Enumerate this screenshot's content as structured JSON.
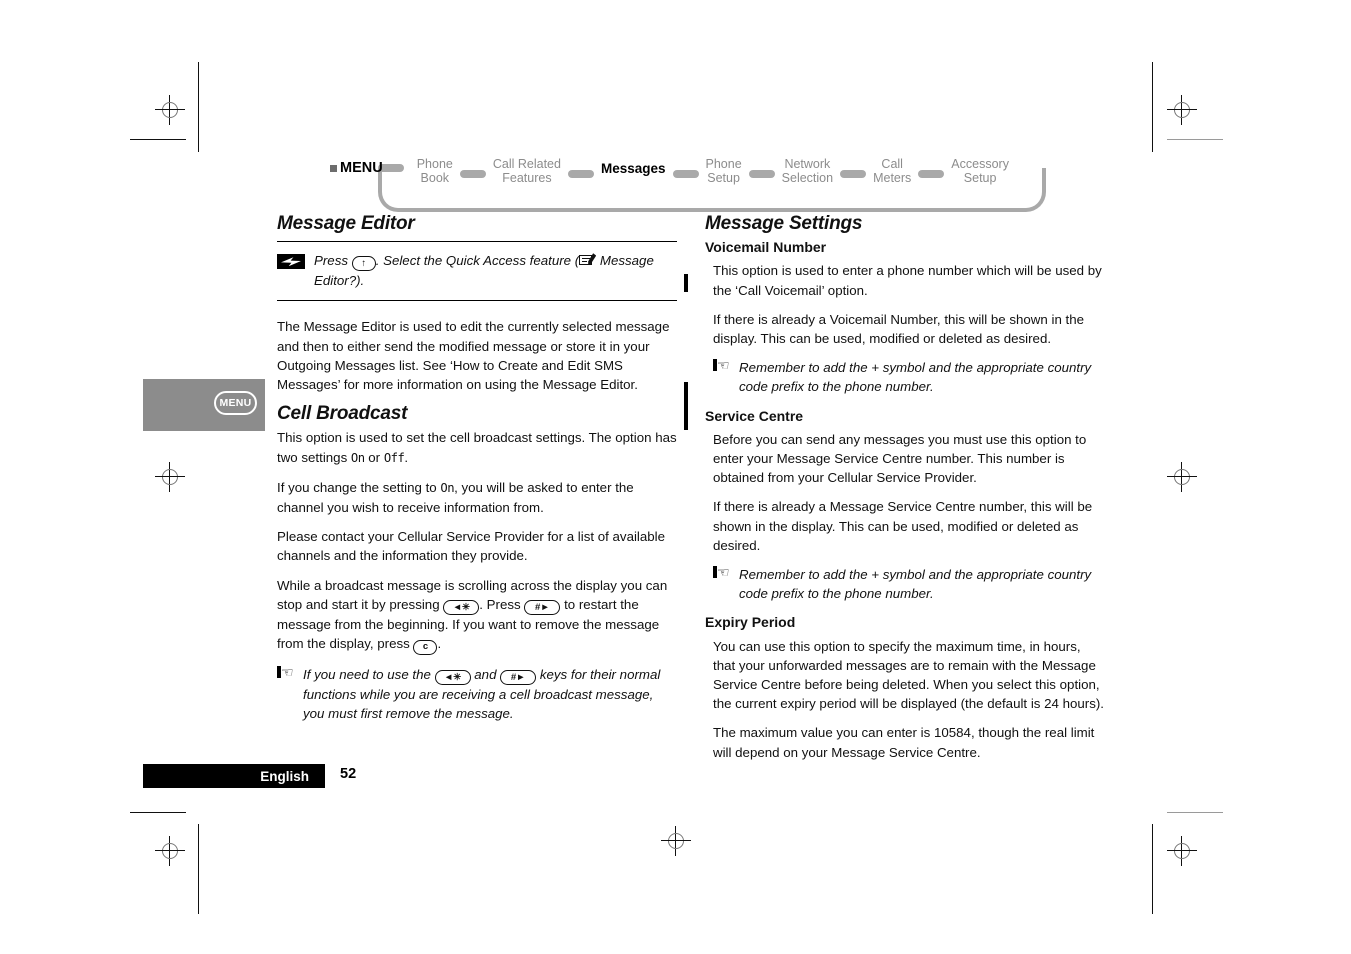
{
  "nav": {
    "menu_label": "MENU",
    "items": [
      {
        "label": "Phone\nBook",
        "current": false
      },
      {
        "label": "Call Related\nFeatures",
        "current": false
      },
      {
        "label": "Messages",
        "current": true
      },
      {
        "label": "Phone\nSetup",
        "current": false
      },
      {
        "label": "Network\nSelection",
        "current": false
      },
      {
        "label": "Call\nMeters",
        "current": false
      },
      {
        "label": "Accessory\nSetup",
        "current": false
      }
    ]
  },
  "side_tab": {
    "menu_key_label": "MENU"
  },
  "left_column": {
    "message_editor": {
      "heading": "Message Editor",
      "callout": {
        "press_label": "Press",
        "key_up": "↑",
        "text_after_key": ". Select the Quick Access feature (",
        "icon": "message-envelope-icon",
        "feature_name": " Message Editor?).",
        "icon_name": "quick-access-bolt-icon"
      },
      "body": "The Message Editor is used to edit the currently selected message and then to either send the modified message or store it in your Outgoing Messages list. See ‘How to Create and Edit SMS Messages’ for more information on using the Message Editor."
    },
    "cell_broadcast": {
      "heading": "Cell Broadcast",
      "p1_a": "This option is used to set the cell broadcast settings. The option has two settings ",
      "p1_on": "On",
      "p1_b": " or ",
      "p1_off": "Off",
      "p1_c": ".",
      "p2_a": "If you change the setting to ",
      "p2_on": "On",
      "p2_b": ", you will be asked to enter the channel you wish to receive information from.",
      "p3": "Please contact your Cellular Service Provider for a list of available channels and the information they provide.",
      "p4_a": "While a broadcast message is scrolling across the display you can stop and start it by pressing ",
      "p4_key1": "◄✳",
      "p4_b": ". Press ",
      "p4_key2": "#►",
      "p4_c": " to restart the message from the beginning. If you want to remove the message from the display, press ",
      "p4_key3": "c",
      "p4_d": ".",
      "note_a": "If you need to use the ",
      "note_key1": "◄✳",
      "note_b": " and ",
      "note_key2": "#►",
      "note_c": " keys for their normal functions while you are receiving a cell broadcast message, you must first remove the message."
    }
  },
  "right_column": {
    "heading": "Message Settings",
    "voicemail": {
      "sub_heading": "Voicemail Number",
      "p1": "This option is used to enter a phone number which will be used by the ‘Call Voicemail’ option.",
      "p2": "If there is already a Voicemail Number, this will be shown in the display. This can be used, modified or deleted as desired.",
      "note": "Remember to add the + symbol and the appropriate country code prefix to the phone number."
    },
    "service_centre": {
      "sub_heading": "Service Centre",
      "p1": "Before you can send any messages you must use this option to enter your Message Service Centre number. This number is obtained from your Cellular Service Provider.",
      "p2": "If there is already a Message Service Centre number, this will be shown in the display. This can be used, modified or deleted as desired.",
      "note": "Remember to add the + symbol and the appropriate country code prefix to the phone number."
    },
    "expiry_period": {
      "sub_heading": "Expiry Period",
      "p1": "You can use this option to specify the maximum time, in hours, that your unforwarded messages are to remain with the Message Service Centre before being deleted. When you select this option, the current expiry period will be displayed (the default is 24 hours).",
      "p2": "The maximum value you can enter is 10584, though the real limit will depend on your Message Service Centre."
    }
  },
  "footer": {
    "language": "English",
    "page_number": "52"
  }
}
